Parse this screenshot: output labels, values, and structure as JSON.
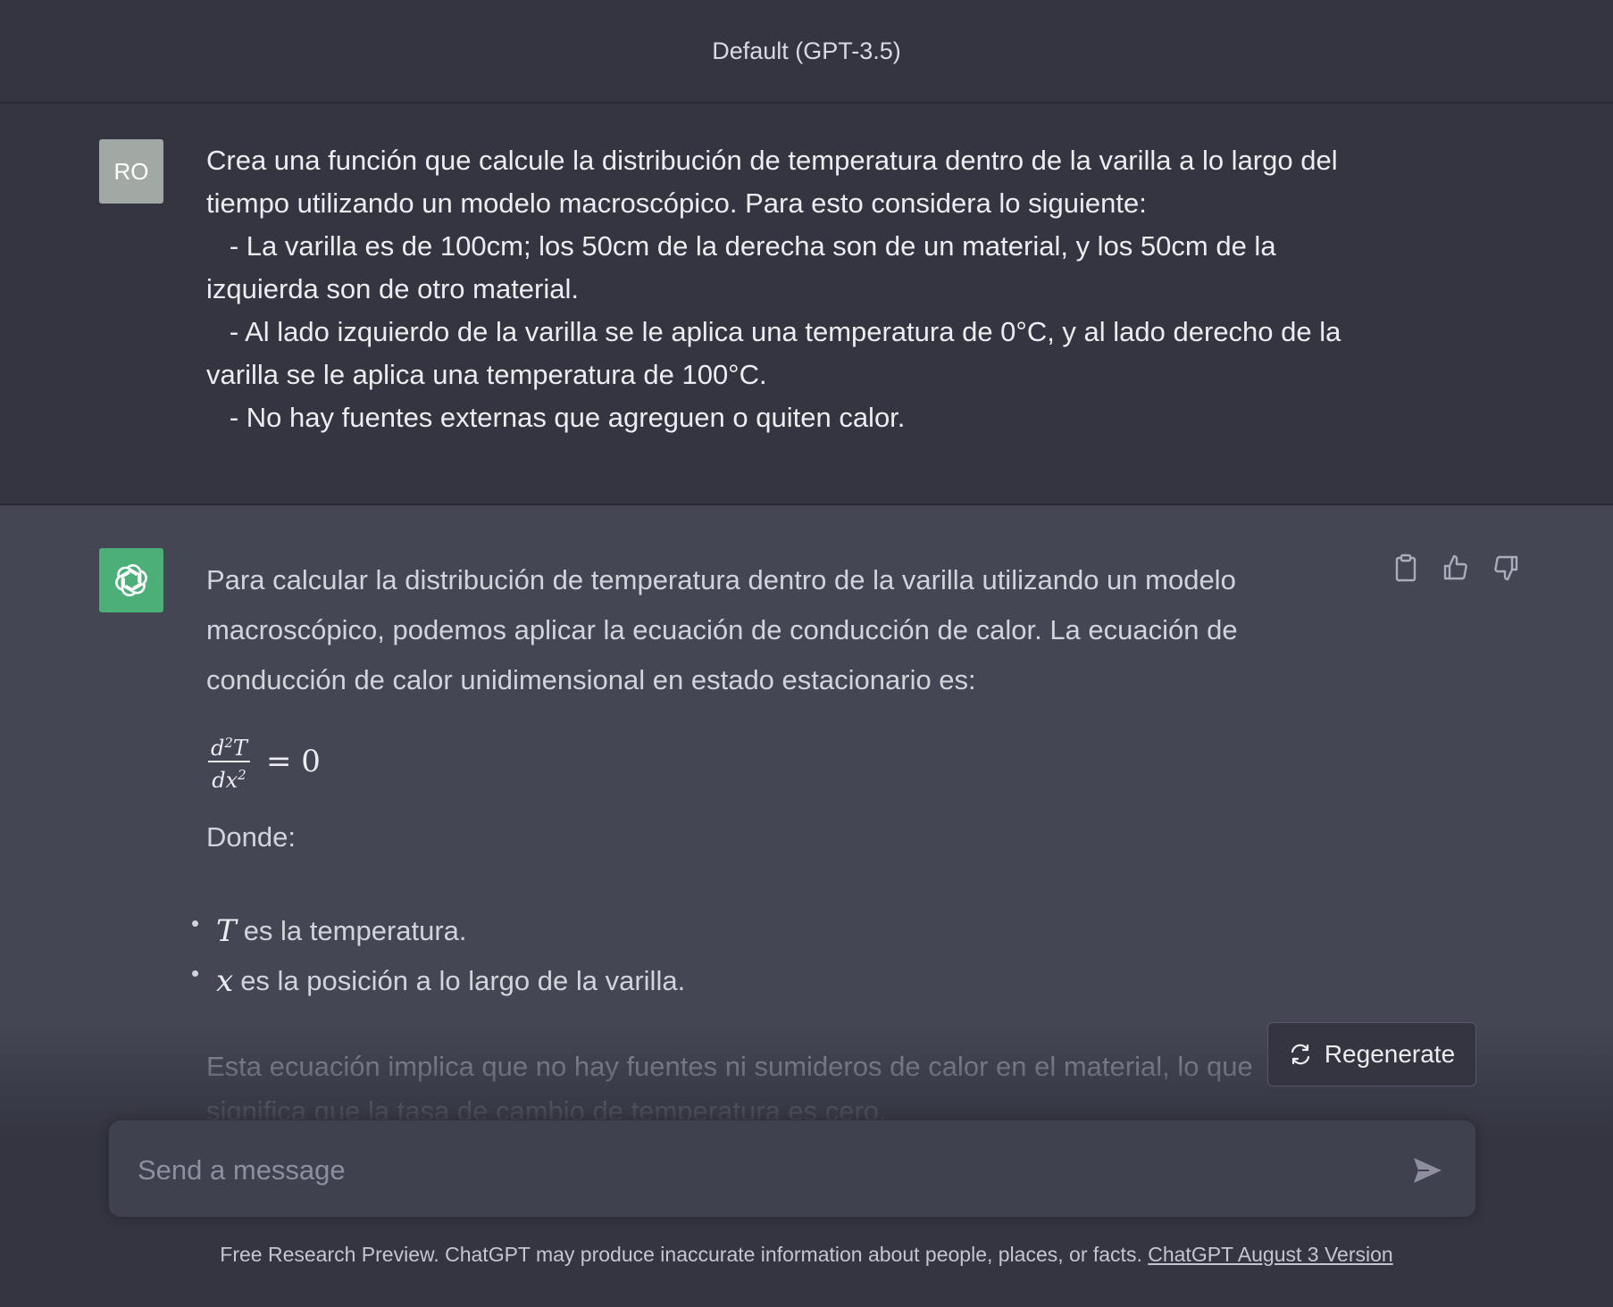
{
  "header": {
    "title": "Default (GPT-3.5)"
  },
  "user_message": {
    "avatar_initials": "RO",
    "lines": [
      "Crea una función que calcule la distribución de temperatura dentro de la varilla a lo largo del",
      "tiempo utilizando un modelo macroscópico. Para esto considera lo siguiente:",
      "   - La varilla es de 100cm; los 50cm de la derecha son de un material, y los 50cm de la",
      "izquierda son de otro material.",
      "   - Al lado izquierdo de la varilla se le aplica una temperatura de 0°C, y al lado derecho de la",
      "varilla se le aplica una temperatura de 100°C.",
      "   - No hay fuentes externas que agreguen o quiten calor."
    ]
  },
  "assistant_message": {
    "avatar_icon": "openai-logo-icon",
    "intro": "Para calcular la distribución de temperatura dentro de la varilla utilizando un modelo macroscópico, podemos aplicar la ecuación de conducción de calor. La ecuación de conducción de calor unidimensional en estado estacionario es:",
    "formula": {
      "numerator": "d",
      "numerator_sup": "2",
      "numerator_var": "T",
      "denominator": "dx",
      "denominator_sup": "2",
      "rhs": "= 0"
    },
    "donde": "Donde:",
    "bullets": [
      {
        "var": "T",
        "text": "es la temperatura."
      },
      {
        "var": "x",
        "text": "es la posición a lo largo de la varilla."
      }
    ],
    "faded_text": "Esta ecuación implica que no hay fuentes ni sumideros de calor en el material, lo que significa que la tasa de cambio de temperatura es cero."
  },
  "actions": {
    "copy": "clipboard-icon",
    "like": "thumbs-up-icon",
    "dislike": "thumbs-down-icon"
  },
  "regenerate": {
    "label": "Regenerate",
    "icon": "refresh-icon"
  },
  "composer": {
    "placeholder": "Send a message",
    "send_icon": "send-icon"
  },
  "footer": {
    "text": "Free Research Preview. ChatGPT may produce inaccurate information about people, places, or facts.",
    "link": "ChatGPT August 3 Version"
  },
  "colors": {
    "bot_avatar": "#4caf78",
    "user_avatar": "#a2a9a5",
    "background_dark": "#343541",
    "background_light": "#444654"
  }
}
